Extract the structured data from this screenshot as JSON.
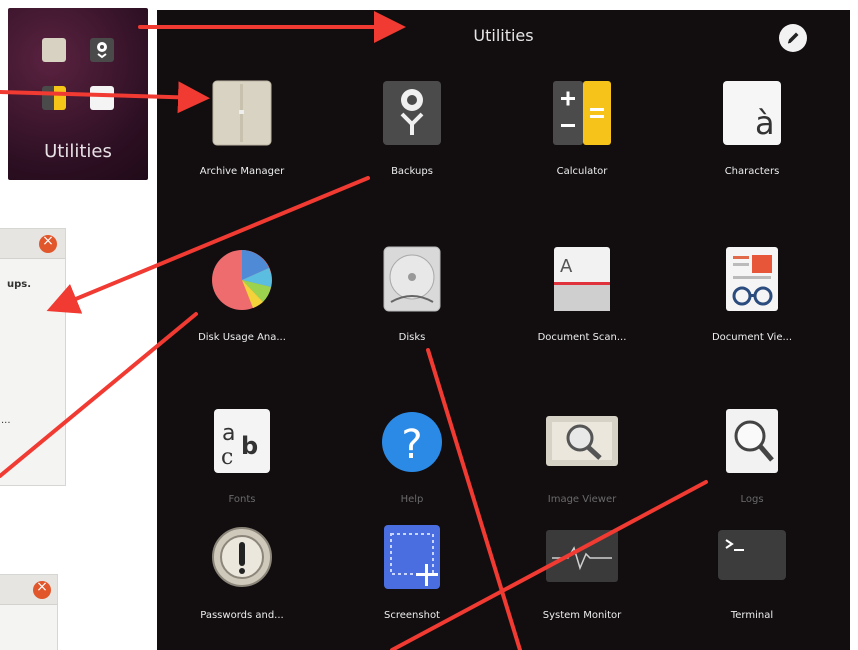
{
  "folder_thumbnail": {
    "label": "Utilities"
  },
  "panel": {
    "title": "Utilities",
    "edit_icon": "pencil-icon"
  },
  "apps": [
    {
      "name": "Archive Manager",
      "icon": "archive-manager-icon"
    },
    {
      "name": "Backups",
      "icon": "backups-icon"
    },
    {
      "name": "Calculator",
      "icon": "calculator-icon"
    },
    {
      "name": "Characters",
      "icon": "characters-icon"
    },
    {
      "name": "Disk Usage Ana...",
      "icon": "disk-usage-analyzer-icon"
    },
    {
      "name": "Disks",
      "icon": "disks-icon"
    },
    {
      "name": "Document Scan...",
      "icon": "document-scanner-icon"
    },
    {
      "name": "Document Vie...",
      "icon": "document-viewer-icon"
    },
    {
      "name": "Fonts",
      "icon": "fonts-icon"
    },
    {
      "name": "Help",
      "icon": "help-icon"
    },
    {
      "name": "Image Viewer",
      "icon": "image-viewer-icon"
    },
    {
      "name": "Logs",
      "icon": "logs-icon"
    },
    {
      "name": "Passwords and...",
      "icon": "passwords-icon"
    },
    {
      "name": "Screenshot",
      "icon": "screenshot-icon"
    },
    {
      "name": "System Monitor",
      "icon": "system-monitor-icon"
    },
    {
      "name": "Terminal",
      "icon": "terminal-icon"
    }
  ],
  "background_windows": {
    "window1_text_a": "ups.",
    "window1_text_b": "..."
  },
  "colors": {
    "annotation_arrow": "#f03a32",
    "panel_background": "#120e10",
    "close_button": "#e2562b"
  }
}
